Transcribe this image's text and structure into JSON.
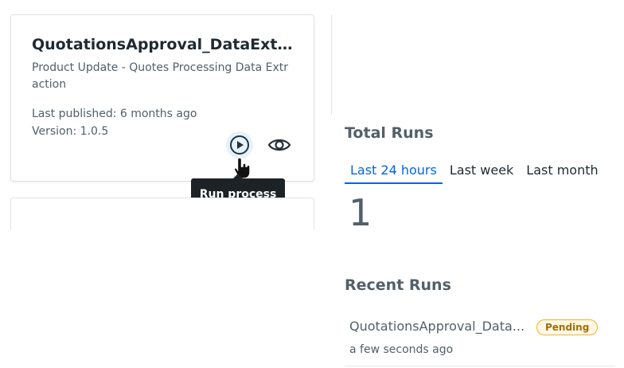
{
  "process_card": {
    "title": "QuotationsApproval_DataExtrac...",
    "description": "Product Update - Quotes Processing Data Extraction",
    "last_published": "Last published: 6 months ago",
    "version": "Version: 1.0.5",
    "run_icon": "play-circle-icon",
    "view_icon": "eye-icon",
    "tooltip": "Run process"
  },
  "total_runs": {
    "title": "Total Runs",
    "tabs": [
      {
        "label": "Last 24 hours",
        "active": true
      },
      {
        "label": "Last week",
        "active": false
      },
      {
        "label": "Last month",
        "active": false
      }
    ],
    "count": "1"
  },
  "recent_runs": {
    "title": "Recent Runs",
    "items": [
      {
        "name": "QuotationsApproval_Data...",
        "status": "Pending",
        "time": "a few seconds ago"
      }
    ]
  },
  "colors": {
    "accent": "#0067df",
    "pending_border": "#f0b429",
    "tooltip_bg": "#1c2226"
  }
}
